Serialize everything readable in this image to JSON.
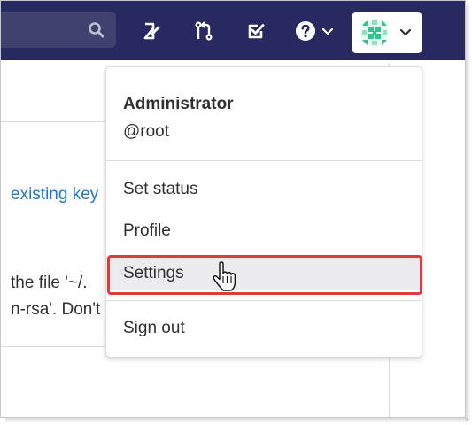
{
  "navbar": {
    "icons": [
      "search-icon",
      "issues-icon",
      "merge-requests-icon",
      "todos-icon",
      "help-icon",
      "chevron-down-icon"
    ],
    "colors": {
      "background": "#292961",
      "search_bg": "#41416f"
    }
  },
  "background_page": {
    "link_fragment": "existing key",
    "line1_fragment": "the file '~/.",
    "line2_fragment": "n-rsa'. Don't"
  },
  "user_menu": {
    "name": "Administrator",
    "username": "@root",
    "items": [
      {
        "label": "Set status"
      },
      {
        "label": "Profile"
      },
      {
        "label": "Settings"
      },
      {
        "label": "Sign out"
      }
    ],
    "highlighted_item": "Settings",
    "highlight_color": "#dd3c3f"
  }
}
